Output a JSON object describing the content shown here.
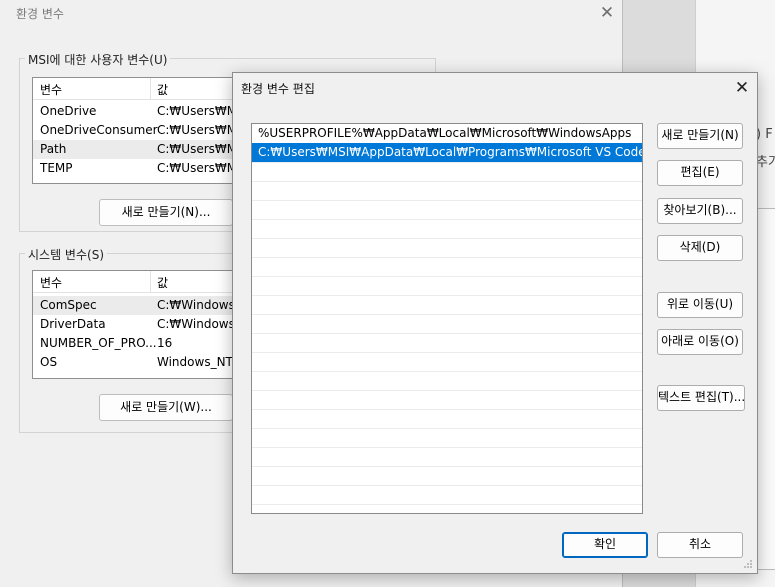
{
  "background_window": {
    "fragment_1": ") F",
    "fragment_2": "추가"
  },
  "env_dialog": {
    "title": "환경 변수",
    "user_group": {
      "label": "MSI에 대한 사용자 변수(U)",
      "columns": [
        "변수",
        "값"
      ],
      "rows": [
        {
          "name": "OneDrive",
          "value": "C:₩Users₩MSI"
        },
        {
          "name": "OneDriveConsumer",
          "value": "C:₩Users₩MSI"
        },
        {
          "name": "Path",
          "value": "C:₩Users₩MSI"
        },
        {
          "name": "TEMP",
          "value": "C:₩Users₩MSI"
        }
      ],
      "new_button": "새로 만들기(N)..."
    },
    "system_group": {
      "label": "시스템 변수(S)",
      "columns": [
        "변수",
        "값"
      ],
      "rows": [
        {
          "name": "ComSpec",
          "value": "C:₩Windows₩"
        },
        {
          "name": "DriverData",
          "value": "C:₩Windows₩"
        },
        {
          "name": "NUMBER_OF_PRO...",
          "value": "16"
        },
        {
          "name": "OS",
          "value": "Windows_NT"
        }
      ],
      "new_button": "새로 만들기(W)..."
    }
  },
  "edit_dialog": {
    "title": "환경 변수 편집",
    "entries": [
      "%USERPROFILE%₩AppData₩Local₩Microsoft₩WindowsApps",
      "C:₩Users₩MSI₩AppData₩Local₩Programs₩Microsoft VS Code₩bin"
    ],
    "selected_index": 1,
    "buttons": {
      "new": "새로 만들기(N)",
      "edit": "편집(E)",
      "browse": "찾아보기(B)...",
      "delete": "삭제(D)",
      "move_up": "위로 이동(U)",
      "move_down": "아래로 이동(O)",
      "edit_text": "텍스트 편집(T)..."
    },
    "ok": "확인",
    "cancel": "취소"
  },
  "icons": {
    "close": "close-icon",
    "resize": "resize-grip-icon"
  },
  "colors": {
    "selection": "#0078d7",
    "dialog_bg": "#f0f0f0"
  }
}
